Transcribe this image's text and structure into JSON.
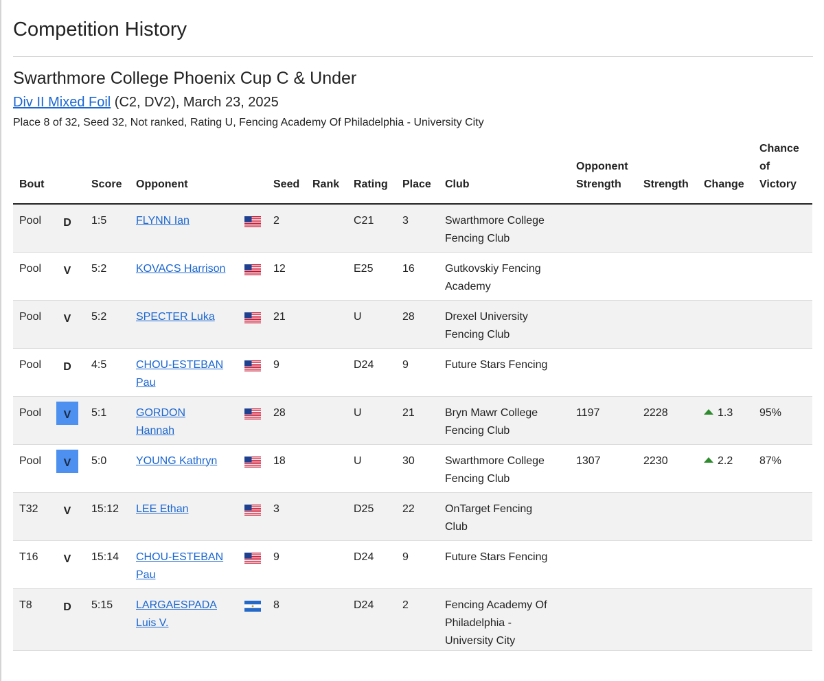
{
  "page_title": "Competition History",
  "event": {
    "title": "Swarthmore College Phoenix Cup C & Under",
    "division_link": "Div II Mixed Foil",
    "division_rest": " (C2, DV2), March 23, 2025",
    "summary": "Place 8 of 32, Seed 32, Not ranked, Rating U, Fencing Academy Of Philadelphia - University City"
  },
  "table": {
    "headers": {
      "bout": "Bout",
      "result": "",
      "score": "Score",
      "opponent": "Opponent",
      "flag": "",
      "seed": "Seed",
      "rank": "Rank",
      "rating": "Rating",
      "place": "Place",
      "club": "Club",
      "opp_strength_1": "Opponent",
      "opp_strength_2": "Strength",
      "strength": "Strength",
      "change": "Change",
      "chance_1": "Chance",
      "chance_2": "of",
      "chance_3": "Victory"
    },
    "rows": [
      {
        "bout": "Pool",
        "result": "D",
        "highlight": false,
        "score": "1:5",
        "opp1": "FLYNN Ian",
        "opp2": "",
        "flag": "us-flag",
        "seed": "2",
        "rank": "",
        "rating": "C21",
        "place": "3",
        "club1": "Swarthmore College",
        "club2": "Fencing Club",
        "club3": "",
        "opp_strength": "",
        "strength": "",
        "change": "",
        "chance": ""
      },
      {
        "bout": "Pool",
        "result": "V",
        "highlight": false,
        "score": "5:2",
        "opp1": "KOVACS Harrison",
        "opp2": "",
        "flag": "us-flag",
        "seed": "12",
        "rank": "",
        "rating": "E25",
        "place": "16",
        "club1": "Gutkovskiy Fencing",
        "club2": "Academy",
        "club3": "",
        "opp_strength": "",
        "strength": "",
        "change": "",
        "chance": ""
      },
      {
        "bout": "Pool",
        "result": "V",
        "highlight": false,
        "score": "5:2",
        "opp1": "SPECTER Luka",
        "opp2": "",
        "flag": "us-flag",
        "seed": "21",
        "rank": "",
        "rating": "U",
        "place": "28",
        "club1": "Drexel University",
        "club2": "Fencing Club",
        "club3": "",
        "opp_strength": "",
        "strength": "",
        "change": "",
        "chance": ""
      },
      {
        "bout": "Pool",
        "result": "D",
        "highlight": false,
        "score": "4:5",
        "opp1": "CHOU-ESTEBAN",
        "opp2": "Pau",
        "flag": "us-flag",
        "seed": "9",
        "rank": "",
        "rating": "D24",
        "place": "9",
        "club1": "Future Stars Fencing",
        "club2": "",
        "club3": "",
        "opp_strength": "",
        "strength": "",
        "change": "",
        "chance": ""
      },
      {
        "bout": "Pool",
        "result": "V",
        "highlight": true,
        "score": "5:1",
        "opp1": "GORDON",
        "opp2": "Hannah",
        "flag": "us-flag",
        "seed": "28",
        "rank": "",
        "rating": "U",
        "place": "21",
        "club1": "Bryn Mawr College",
        "club2": "Fencing Club",
        "club3": "",
        "opp_strength": "1197",
        "strength": "2228",
        "change": "1.3",
        "chance": "95%"
      },
      {
        "bout": "Pool",
        "result": "V",
        "highlight": true,
        "score": "5:0",
        "opp1": "YOUNG Kathryn",
        "opp2": "",
        "flag": "us-flag",
        "seed": "18",
        "rank": "",
        "rating": "U",
        "place": "30",
        "club1": "Swarthmore College",
        "club2": "Fencing Club",
        "club3": "",
        "opp_strength": "1307",
        "strength": "2230",
        "change": "2.2",
        "chance": "87%"
      },
      {
        "bout": "T32",
        "result": "V",
        "highlight": false,
        "score": "15:12",
        "opp1": "LEE Ethan",
        "opp2": "",
        "flag": "us-flag",
        "seed": "3",
        "rank": "",
        "rating": "D25",
        "place": "22",
        "club1": "OnTarget Fencing",
        "club2": "Club",
        "club3": "",
        "opp_strength": "",
        "strength": "",
        "change": "",
        "chance": ""
      },
      {
        "bout": "T16",
        "result": "V",
        "highlight": false,
        "score": "15:14",
        "opp1": "CHOU-ESTEBAN",
        "opp2": "Pau",
        "flag": "us-flag",
        "seed": "9",
        "rank": "",
        "rating": "D24",
        "place": "9",
        "club1": "Future Stars Fencing",
        "club2": "",
        "club3": "",
        "opp_strength": "",
        "strength": "",
        "change": "",
        "chance": ""
      },
      {
        "bout": "T8",
        "result": "D",
        "highlight": false,
        "score": "5:15",
        "opp1": "LARGAESPADA",
        "opp2": "Luis V.",
        "flag": "nicaragua-flag",
        "seed": "8",
        "rank": "",
        "rating": "D24",
        "place": "2",
        "club1": "Fencing Academy Of",
        "club2": "Philadelphia -",
        "club3": "University City",
        "opp_strength": "",
        "strength": "",
        "change": "",
        "chance": ""
      }
    ]
  },
  "colors": {
    "link": "#1b66d1",
    "victory_highlight": "#4d90f0",
    "change_up": "#2e8b2e",
    "row_stripe": "#f2f2f2"
  }
}
